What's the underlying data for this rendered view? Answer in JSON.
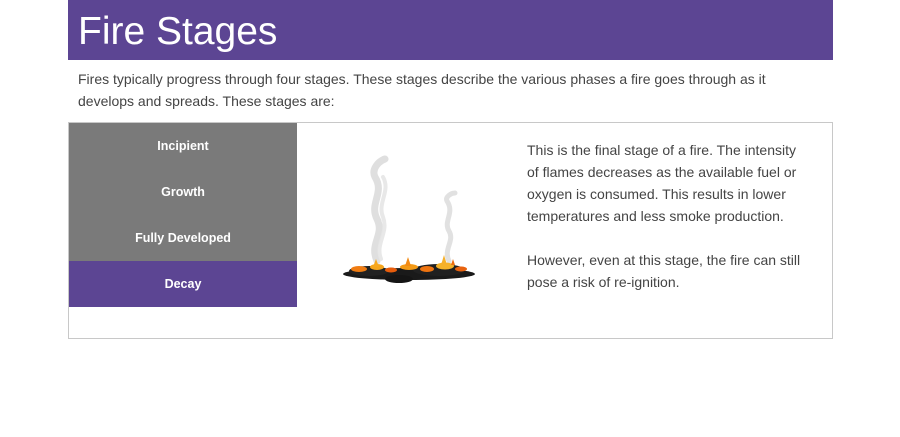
{
  "header": {
    "title": "Fire Stages"
  },
  "intro": {
    "text": "Fires typically progress through four stages. These stages describe the various phases a fire goes through as it develops and spreads. These stages are:"
  },
  "tabs": [
    {
      "label": "Incipient",
      "active": false
    },
    {
      "label": "Growth",
      "active": false
    },
    {
      "label": "Fully Developed",
      "active": false
    },
    {
      "label": "Decay",
      "active": true
    }
  ],
  "content": {
    "image_icon": "smoldering-embers-icon",
    "paragraph_1": "This is the final stage of a fire. The intensity of flames decreases as the available fuel or oxygen is consumed. This results in lower temperatures and less smoke production.",
    "paragraph_2": "However, even at this stage, the fire can still pose a risk of re-ignition."
  },
  "colors": {
    "accent": "#5c4593",
    "tab_inactive": "#7a7a7a",
    "text": "#444444"
  }
}
